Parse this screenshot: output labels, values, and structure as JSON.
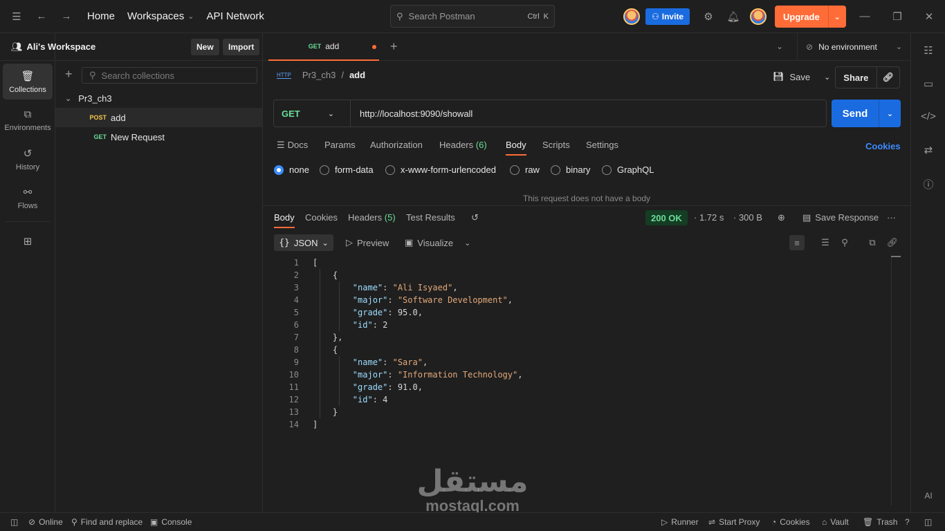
{
  "topbar": {
    "nav": [
      "Home",
      "Workspaces",
      "API Network"
    ],
    "search_placeholder": "Search Postman",
    "shortcut_ctrl": "Ctrl",
    "shortcut_key": "K",
    "invite_label": "Invite",
    "upgrade_label": "Upgrade"
  },
  "workspace": {
    "name": "Ali's Workspace",
    "new_label": "New",
    "import_label": "Import"
  },
  "rail": [
    {
      "label": "Collections",
      "icon": "collections-icon"
    },
    {
      "label": "Environments",
      "icon": "environments-icon"
    },
    {
      "label": "History",
      "icon": "history-icon"
    },
    {
      "label": "Flows",
      "icon": "flows-icon"
    }
  ],
  "sidebar": {
    "search_placeholder": "Search collections",
    "collection": "Pr3_ch3",
    "requests": [
      {
        "method": "POST",
        "name": "add"
      },
      {
        "method": "GET",
        "name": "New Request"
      }
    ]
  },
  "tab": {
    "method": "GET",
    "name": "add"
  },
  "environment": "No environment",
  "breadcrumb": {
    "collection": "Pr3_ch3",
    "separator": "/",
    "request": "add",
    "badge": "HTTP"
  },
  "actions": {
    "save": "Save",
    "share": "Share"
  },
  "request": {
    "method": "GET",
    "url": "http://localhost:9090/showall",
    "send_label": "Send",
    "tabs": [
      "Docs",
      "Params",
      "Authorization",
      "Headers",
      "Body",
      "Scripts",
      "Settings"
    ],
    "headers_count": "(6)",
    "active_tab": "Body",
    "cookies_link": "Cookies",
    "body_types": [
      "none",
      "form-data",
      "x-www-form-urlencoded",
      "raw",
      "binary",
      "GraphQL"
    ],
    "selected_body_type": "none",
    "empty_body_message": "This request does not have a body"
  },
  "response": {
    "tabs": [
      "Body",
      "Cookies",
      "Headers",
      "Test Results"
    ],
    "headers_count": "(5)",
    "status": "200 OK",
    "time": "1.72 s",
    "size": "300 B",
    "save_response": "Save Response",
    "format": "JSON",
    "preview": "Preview",
    "visualize": "Visualize",
    "lines": [
      "[",
      "    {",
      "        \"name\": \"Ali Isyaed\",",
      "        \"major\": \"Software Development\",",
      "        \"grade\": 95.0,",
      "        \"id\": 2",
      "    },",
      "    {",
      "        \"name\": \"Sara\",",
      "        \"major\": \"Information Technology\",",
      "        \"grade\": 91.0,",
      "        \"id\": 4",
      "    }",
      "]"
    ]
  },
  "statusbar": {
    "online": "Online",
    "find_replace": "Find and replace",
    "console": "Console",
    "runner": "Runner",
    "proxy": "Start Proxy",
    "cookies": "Cookies",
    "vault": "Vault",
    "trash": "Trash"
  },
  "watermark": {
    "arabic": "مستقل",
    "latin": "mostaql.com"
  },
  "colors": {
    "accent": "#ff6c37",
    "primary": "#1a6be0",
    "get": "#6bdd9a",
    "post": "#f5c74a",
    "status_ok": "#6bdd9a"
  }
}
